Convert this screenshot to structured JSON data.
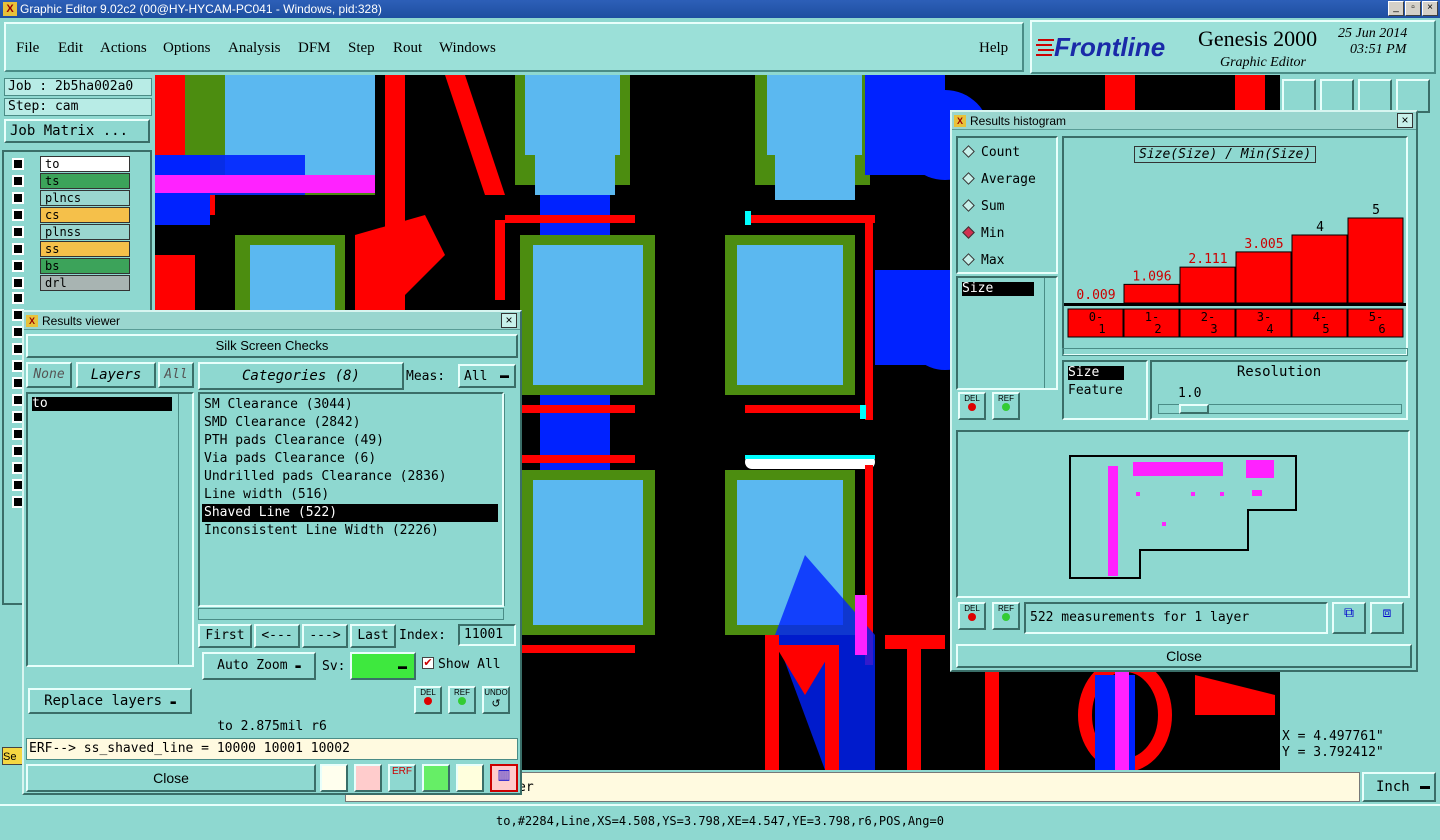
{
  "window": {
    "title": "Graphic Editor 9.02c2 (00@HY-HYCAM-PC041 - Windows, pid:328)"
  },
  "menu": [
    "File",
    "Edit",
    "Actions",
    "Options",
    "Analysis",
    "DFM",
    "Step",
    "Rout",
    "Windows"
  ],
  "help": "Help",
  "brand": {
    "logo": "Frontline",
    "product": "Genesis 2000",
    "subtitle": "Graphic Editor",
    "date": "25 Jun 2014",
    "time": "03:51 PM"
  },
  "left": {
    "job": "Job : 2b5ha002a0",
    "step": "Step: cam",
    "job_matrix": "Job Matrix ...",
    "layers": [
      {
        "name": "to",
        "color": "#ffffff"
      },
      {
        "name": "ts",
        "color": "#3ca35a"
      },
      {
        "name": "plncs",
        "color": "#9ad6cf"
      },
      {
        "name": "cs",
        "color": "#f5c04a"
      },
      {
        "name": "plnss",
        "color": "#9ad6cf"
      },
      {
        "name": "ss",
        "color": "#f5c04a"
      },
      {
        "name": "bs",
        "color": "#3ca35a"
      },
      {
        "name": "drl",
        "color": "#a8b4b2"
      }
    ],
    "side_label": "Se"
  },
  "results_viewer": {
    "title": "Results viewer",
    "header": "Silk Screen Checks",
    "btn_none": "None",
    "btn_layers": "Layers",
    "btn_all": "All",
    "layers_list": [
      "to"
    ],
    "categories_label": "Categories (8)",
    "meas_label": "Meas:",
    "meas_value": "All",
    "categories": [
      "SM Clearance (3044)",
      "SMD Clearance (2842)",
      "PTH pads Clearance (49)",
      "Via pads Clearance (6)",
      "Undrilled pads Clearance (2836)",
      "Line width (516)",
      "Shaved Line (522)",
      "Inconsistent Line Width (2226)"
    ],
    "selected_category": 6,
    "nav": {
      "first": "First",
      "prev": "<---",
      "next": "--->",
      "last": "Last",
      "index_label": "Index:",
      "index_value": "11001"
    },
    "auto_zoom": "Auto Zoom",
    "sv_label": "Sv:",
    "show_all": "Show All",
    "replace_layers": "Replace layers",
    "small_btns": [
      "DEL",
      "REF",
      "UNDO"
    ],
    "measure_text": "to 2.875mil  r6",
    "erf_text": "ERF--> ss_shaved_line = 10000 10001 10002",
    "close": "Close"
  },
  "histogram": {
    "title": "Results histogram",
    "options": [
      "Count",
      "Average",
      "Sum",
      "Min",
      "Max"
    ],
    "selected_option": "Min",
    "graph_title": "Size(Size) / Min(Size)",
    "bins": [
      "0-\n1",
      "1-\n2",
      "2-\n3",
      "3-\n4",
      "4-\n5",
      "5-\n6"
    ],
    "bar_labels": [
      "0.009",
      "1.096",
      "2.111",
      "3.005",
      "4",
      "5"
    ],
    "attr_list": [
      "Size"
    ],
    "sort_list": [
      "Size",
      "Feature"
    ],
    "resolution_label": "Resolution",
    "resolution_value": "1.0",
    "measurements": "522 measurements for 1 layer",
    "small_btns": [
      "DEL",
      "REF"
    ],
    "close": "Close"
  },
  "chart_data": {
    "type": "bar",
    "title": "Size(Size) / Min(Size)",
    "categories": [
      "0-1",
      "1-2",
      "2-3",
      "3-4",
      "4-5",
      "5-6"
    ],
    "values": [
      0.009,
      1.096,
      2.111,
      3.005,
      4,
      5
    ],
    "ylim": [
      0,
      5.5
    ]
  },
  "coords": {
    "x": "X = 4.497761\"",
    "y": "Y = 3.792412\""
  },
  "units": "Inch",
  "status_text": "to,#2284,Line,XS=4.508,YS=3.798,XE=4.547,YE=3.798,r6,POS,Ang=0",
  "status_partial": "er"
}
